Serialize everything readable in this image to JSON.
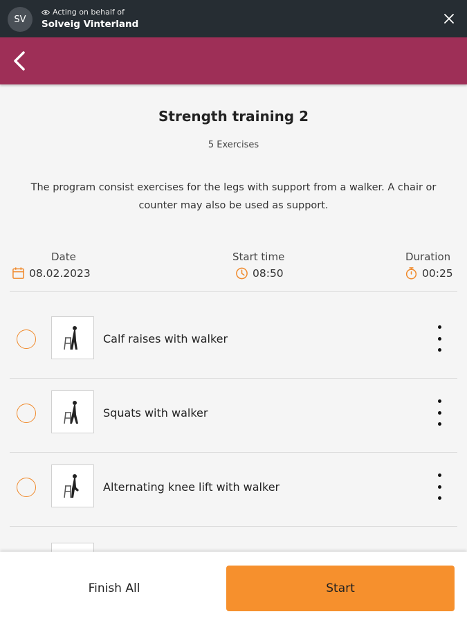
{
  "topbar": {
    "avatar_initials": "SV",
    "acting_label": "Acting on behalf of",
    "acting_name": "Solveig Vinterland"
  },
  "program": {
    "title": "Strength training 2",
    "exercise_count": "5 Exercises",
    "description": "The program consist exercises for the legs with support from a walker. A chair or counter may also be used as support."
  },
  "meta": {
    "date_label": "Date",
    "date_value": "08.02.2023",
    "start_label": "Start time",
    "start_value": "08:50",
    "duration_label": "Duration",
    "duration_value": "00:25"
  },
  "exercises": [
    {
      "name": "Calf raises with walker"
    },
    {
      "name": "Squats with walker"
    },
    {
      "name": "Alternating knee lift with walker"
    }
  ],
  "footer": {
    "finish_label": "Finish All",
    "start_label": "Start"
  },
  "colors": {
    "topbar": "#262d33",
    "appbar": "#9e2f57",
    "accent": "#f6902d",
    "icon_orange": "#f08a2c"
  },
  "icons": [
    "eye-icon",
    "close-icon",
    "back-arrow-icon",
    "calendar-icon",
    "clock-icon",
    "stopwatch-icon",
    "kebab-menu-icon"
  ]
}
